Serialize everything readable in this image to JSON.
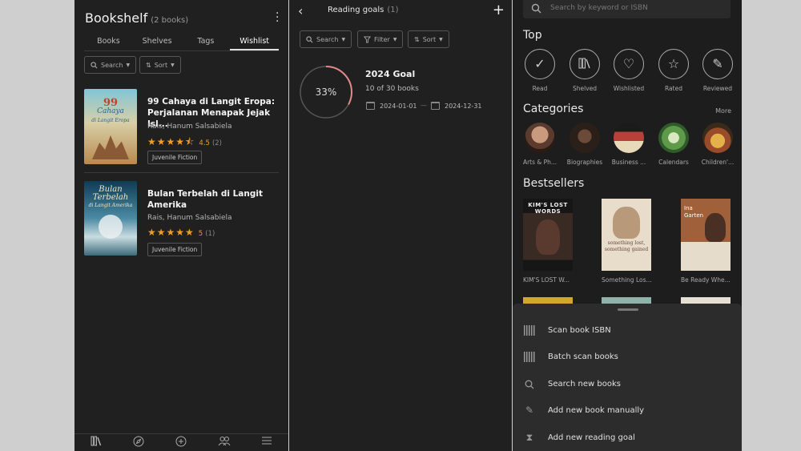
{
  "bookshelf": {
    "title": "Bookshelf",
    "count": "(2 books)",
    "tabs": [
      "Books",
      "Shelves",
      "Tags",
      "Wishlist"
    ],
    "active_tab": "Wishlist",
    "search_label": "Search",
    "sort_label": "Sort",
    "books": [
      {
        "title": "99 Cahaya di Langit Eropa: Perjalanan Menapak Jejak Isl...",
        "author": "Rais, Hanum Salsabiela",
        "stars": "★★★★⯪",
        "rating": "4.5",
        "rating_count": "(2)",
        "tag": "Juvenile Fiction",
        "cover_text": [
          "99",
          "Cahaya",
          "di Langit Eropa"
        ]
      },
      {
        "title": "Bulan Terbelah di Langit Amerika",
        "author": "Rais, Hanum Salsabiela",
        "stars": "★★★★★",
        "rating": "5",
        "rating_count": "(1)",
        "tag": "Juvenile Fiction",
        "cover_text": [
          "Bulan",
          "Terbelah",
          "di Langit Amerika"
        ]
      }
    ]
  },
  "goals": {
    "title": "Reading goals",
    "count": "(1)",
    "filters": [
      "Search",
      "Filter",
      "Sort"
    ],
    "goal": {
      "name": "2024 Goal",
      "percent_label": "33%",
      "progress_fraction": 0.33,
      "progress_text": "10 of 30 books",
      "start_date": "2024-01-01",
      "end_date": "2024-12-31"
    }
  },
  "discover": {
    "search_placeholder": "Search by keyword or ISBN",
    "top_title": "Top",
    "top_items": [
      {
        "label": "Read",
        "icon": "check-icon"
      },
      {
        "label": "Shelved",
        "icon": "shelf-icon"
      },
      {
        "label": "Wishlisted",
        "icon": "heart-icon"
      },
      {
        "label": "Rated",
        "icon": "star-icon"
      },
      {
        "label": "Reviewed",
        "icon": "pencil-icon"
      }
    ],
    "categories_title": "Categories",
    "more_label": "More",
    "categories": [
      "Arts & Ph...",
      "Biographies",
      "Business ...",
      "Calendars",
      "Children'..."
    ],
    "bestsellers_title": "Bestsellers",
    "bestsellers": [
      "KIM'S LOST W...",
      "Something Los...",
      "Be Ready Whe..."
    ],
    "bestseller_cover_text": [
      "KIM'S LOST WORDS",
      "something lost, something gained",
      "Ina Garten"
    ]
  },
  "sheet": {
    "items": [
      {
        "label": "Scan book ISBN",
        "icon": "barcode-icon"
      },
      {
        "label": "Batch scan books",
        "icon": "barcode-icon"
      },
      {
        "label": "Search new books",
        "icon": "search-icon"
      },
      {
        "label": "Add new book manually",
        "icon": "pencil-icon"
      },
      {
        "label": "Add new reading goal",
        "icon": "hourglass-icon"
      }
    ]
  }
}
